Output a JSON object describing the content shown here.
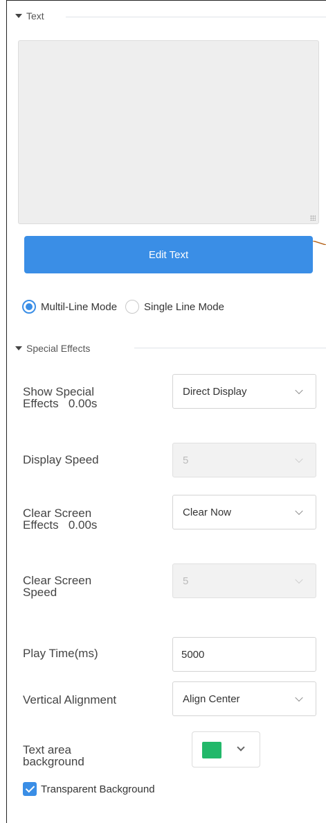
{
  "text_section": {
    "title": "Text",
    "textarea_value": "",
    "edit_button_label": "Edit Text",
    "modes": [
      {
        "label": "Multil-Line Mode",
        "checked": true
      },
      {
        "label": "Single Line Mode",
        "checked": false
      }
    ]
  },
  "effects_section": {
    "title": "Special Effects",
    "show_effects": {
      "label_line1": "Show Special",
      "label_line2": "Effects   0.00s",
      "value": "Direct Display"
    },
    "display_speed": {
      "label": "Display Speed",
      "value": "5"
    },
    "clear_effects": {
      "label_line1": "Clear Screen",
      "label_line2": "Effects   0.00s",
      "value": "Clear Now"
    },
    "clear_speed": {
      "label_line1": "Clear Screen",
      "label_line2": "Speed",
      "value": "5"
    },
    "play_time": {
      "label": "Play Time(ms)",
      "value": "5000"
    },
    "vertical_alignment": {
      "label": "Vertical Alignment",
      "value": "Align Center"
    },
    "text_area_background": {
      "label_line1": "Text area",
      "label_line2": "background",
      "color": "#22b86a"
    },
    "transparent_background": {
      "label": "Transparent Background",
      "checked": true
    }
  },
  "colors": {
    "accent": "#3a8ee6",
    "connector": "#b5651d"
  }
}
